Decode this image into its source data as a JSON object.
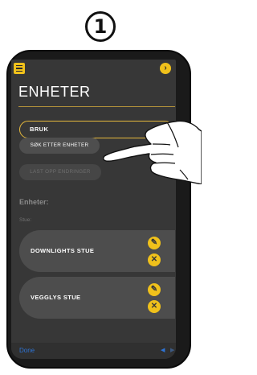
{
  "step_number": "1",
  "header": {
    "title": "ENHETER",
    "menu_icon": "hamburger-menu-icon",
    "next_icon": "chevron-right-icon"
  },
  "actions": {
    "bruk_label": "BRUK",
    "search_label": "SØK ETTER ENHETER",
    "upload_label": "LAST OPP ENDRINGER"
  },
  "devices_section": {
    "title": "Enheter:",
    "room": "Stue:",
    "items": [
      {
        "name": "DOWNLIGHTS STUE",
        "edit_icon": "pencil-icon",
        "delete_icon": "close-icon"
      },
      {
        "name": "VEGGLYS STUE",
        "edit_icon": "pencil-icon",
        "delete_icon": "close-icon"
      }
    ]
  },
  "toolbar": {
    "done_label": "Done",
    "prev_icon": "arrow-left-icon",
    "next_icon": "arrow-right-icon"
  },
  "overlay": {
    "hand_icon": "pointing-hand-icon"
  },
  "colors": {
    "accent": "#f0c11b",
    "screen_bg": "#373737",
    "card_bg": "#4d4d4d",
    "link": "#2e74d6"
  }
}
